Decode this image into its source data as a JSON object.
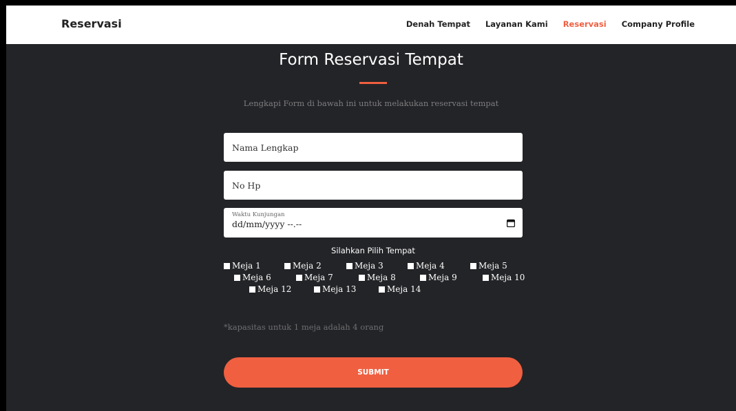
{
  "navbar": {
    "brand": "Reservasi",
    "links": [
      "Denah Tempat",
      "Layanan Kami",
      "Reservasi",
      "Company Profile"
    ]
  },
  "form": {
    "title": "Form Reservasi Tempat",
    "subtitle": "Lengkapi Form di bawah ini untuk melakukan reservasi tempat",
    "name_placeholder": "Nama Lengkap",
    "phone_placeholder": "No Hp",
    "visit_label": "Waktu Kunjungan",
    "visit_value": "dd/mm/yyyy --.--",
    "pick_label": "Silahkan Pilih Tempat",
    "tables": [
      "Meja 1",
      "Meja 2",
      "Meja 3",
      "Meja 4",
      "Meja 5",
      "Meja 6",
      "Meja 7",
      "Meja 8",
      "Meja 9",
      "Meja 10",
      "Meja 12",
      "Meja 13",
      "Meja 14"
    ],
    "note": "*kapasitas untuk 1 meja adalah 4 orang",
    "submit_label": "SUBMIT"
  },
  "colors": {
    "accent": "#f05f40",
    "background": "#232427"
  }
}
